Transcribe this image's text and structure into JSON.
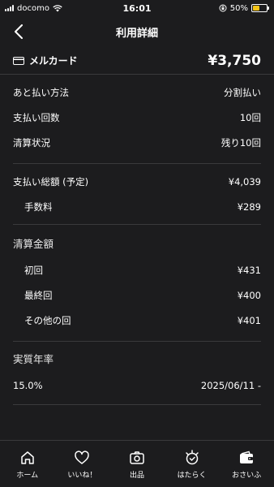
{
  "status_bar": {
    "carrier": "docomo",
    "time": "16:01",
    "battery_percent": "50%",
    "battery_level": 0.5
  },
  "nav": {
    "title": "利用詳細",
    "back_icon": "chevron-left-icon"
  },
  "card": {
    "icon": "card-icon",
    "label": "メルカード",
    "amount": "¥3,750"
  },
  "payment": {
    "method_label": "あと払い方法",
    "method_value": "分割払い",
    "count_label": "支払い回数",
    "count_value": "10回",
    "status_label": "清算状況",
    "status_value": "残り10回"
  },
  "totals": {
    "total_label": "支払い総額 (予定)",
    "total_value": "¥4,039",
    "fee_label": "手数料",
    "fee_value": "¥289"
  },
  "settlement": {
    "heading": "清算金額",
    "first_label": "初回",
    "first_value": "¥431",
    "last_label": "最終回",
    "last_value": "¥400",
    "other_label": "その他の回",
    "other_value": "¥401"
  },
  "apr": {
    "heading": "実質年率",
    "rate": "15.0%",
    "date": "2025/06/11 -"
  },
  "tabs": [
    {
      "label": "ホーム",
      "icon": "home-icon"
    },
    {
      "label": "いいね！",
      "icon": "heart-icon"
    },
    {
      "label": "出品",
      "icon": "camera-icon"
    },
    {
      "label": "はたらく",
      "icon": "work-icon"
    },
    {
      "label": "おさいふ",
      "icon": "wallet-icon"
    }
  ],
  "colors": {
    "background": "#1c1c1e",
    "divider": "#3a3a3c",
    "battery": "#f5c518",
    "text": "#ffffff"
  }
}
